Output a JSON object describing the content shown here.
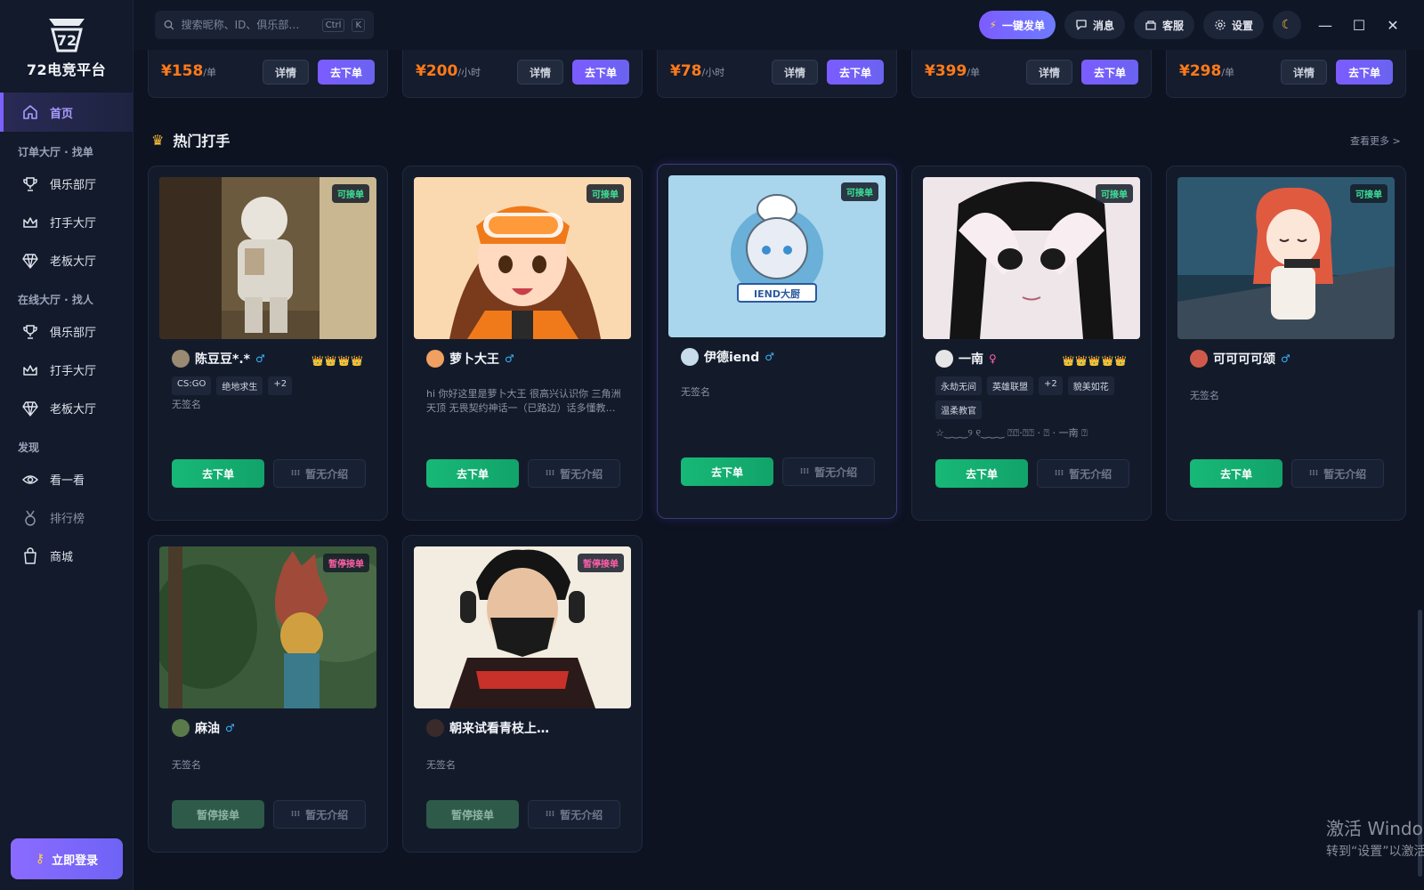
{
  "app": {
    "name": "72电竞平台",
    "logo_text": "72"
  },
  "sidebar": {
    "home_label": "首页",
    "sections": [
      {
        "title": "订单大厅 · 找单",
        "items": [
          "俱乐部厅",
          "打手大厅",
          "老板大厅"
        ]
      },
      {
        "title": "在线大厅 · 找人",
        "items": [
          "俱乐部厅",
          "打手大厅",
          "老板大厅"
        ]
      },
      {
        "title": "发现",
        "items": [
          "看一看",
          "排行榜",
          "商城"
        ]
      }
    ],
    "login_label": "立即登录"
  },
  "topbar": {
    "search_placeholder": "搜索昵称、ID、俱乐部…",
    "shortcut": [
      "Ctrl",
      "K"
    ],
    "quick_order": "一键发单",
    "messages": "消息",
    "support": "客服",
    "settings": "设置",
    "theme_icon": "moon-icon"
  },
  "products": [
    {
      "price": "¥158",
      "unit": "/单",
      "detail": "详情",
      "order": "去下单"
    },
    {
      "price": "¥200",
      "unit": "/小时",
      "detail": "详情",
      "order": "去下单"
    },
    {
      "price": "¥78",
      "unit": "/小时",
      "detail": "详情",
      "order": "去下单"
    },
    {
      "price": "¥399",
      "unit": "/单",
      "detail": "详情",
      "order": "去下单"
    },
    {
      "price": "¥298",
      "unit": "/单",
      "detail": "详情",
      "order": "去下单"
    }
  ],
  "section": {
    "title": "热门打手",
    "more": "查看更多 >"
  },
  "players": [
    {
      "name": "陈豆豆*.*",
      "gender": "♂",
      "status": "可接单",
      "crowns": "👑👑👑👑",
      "tags": [
        "CS:GO",
        "绝地求生",
        "+2"
      ],
      "signature": "无签名",
      "order": "去下单",
      "intro": "暂无介绍"
    },
    {
      "name": "萝卜大王",
      "gender": "♂",
      "status": "可接单",
      "crowns": "",
      "tags": [],
      "signature": "hi 你好这里是萝卜大王 很高兴认识你 三角洲天顶 无畏契约神话一（已路边）话多懂教…",
      "order": "去下单",
      "intro": "暂无介绍"
    },
    {
      "name": "伊德iend",
      "gender": "♂",
      "status": "可接单",
      "crowns": "",
      "tags": [],
      "signature": "无签名",
      "order": "去下单",
      "intro": "暂无介绍",
      "image_text": "IEND大厨"
    },
    {
      "name": "一南",
      "gender": "♀",
      "status": "可接单",
      "crowns": "👑👑👑👑👑",
      "tags": [
        "永劫无间",
        "英雄联盟",
        "+2",
        "貌美如花",
        "温柔教官"
      ],
      "signature": "☆‿‿‿୨ ୧‿‿‿ ⍰⍰·⍰⍰ · ⍰ · 一南 ⍰",
      "order": "去下单",
      "intro": "暂无介绍"
    },
    {
      "name": "可可可可颂",
      "gender": "♂",
      "status": "可接单",
      "crowns": "",
      "tags": [],
      "signature": "无签名",
      "order": "去下单",
      "intro": "暂无介绍"
    },
    {
      "name": "麻油",
      "gender": "♂",
      "status": "暂停接单",
      "crowns": "",
      "tags": [],
      "signature": "无签名",
      "order": "暂停接单",
      "intro": "暂无介绍"
    },
    {
      "name": "朝来试看青枝上…",
      "gender": "",
      "status": "暂停接单",
      "crowns": "",
      "tags": [],
      "signature": "无签名",
      "order": "暂停接单",
      "intro": "暂无介绍"
    }
  ],
  "watermark": {
    "line1": "激活 Windo",
    "line2": "转到“设置”以激活"
  },
  "colors": {
    "accent": "#7c5cff",
    "price": "#ff7a1a",
    "available": "#3de39a",
    "paused": "#ff5fa8",
    "order_btn": "#17b877"
  }
}
